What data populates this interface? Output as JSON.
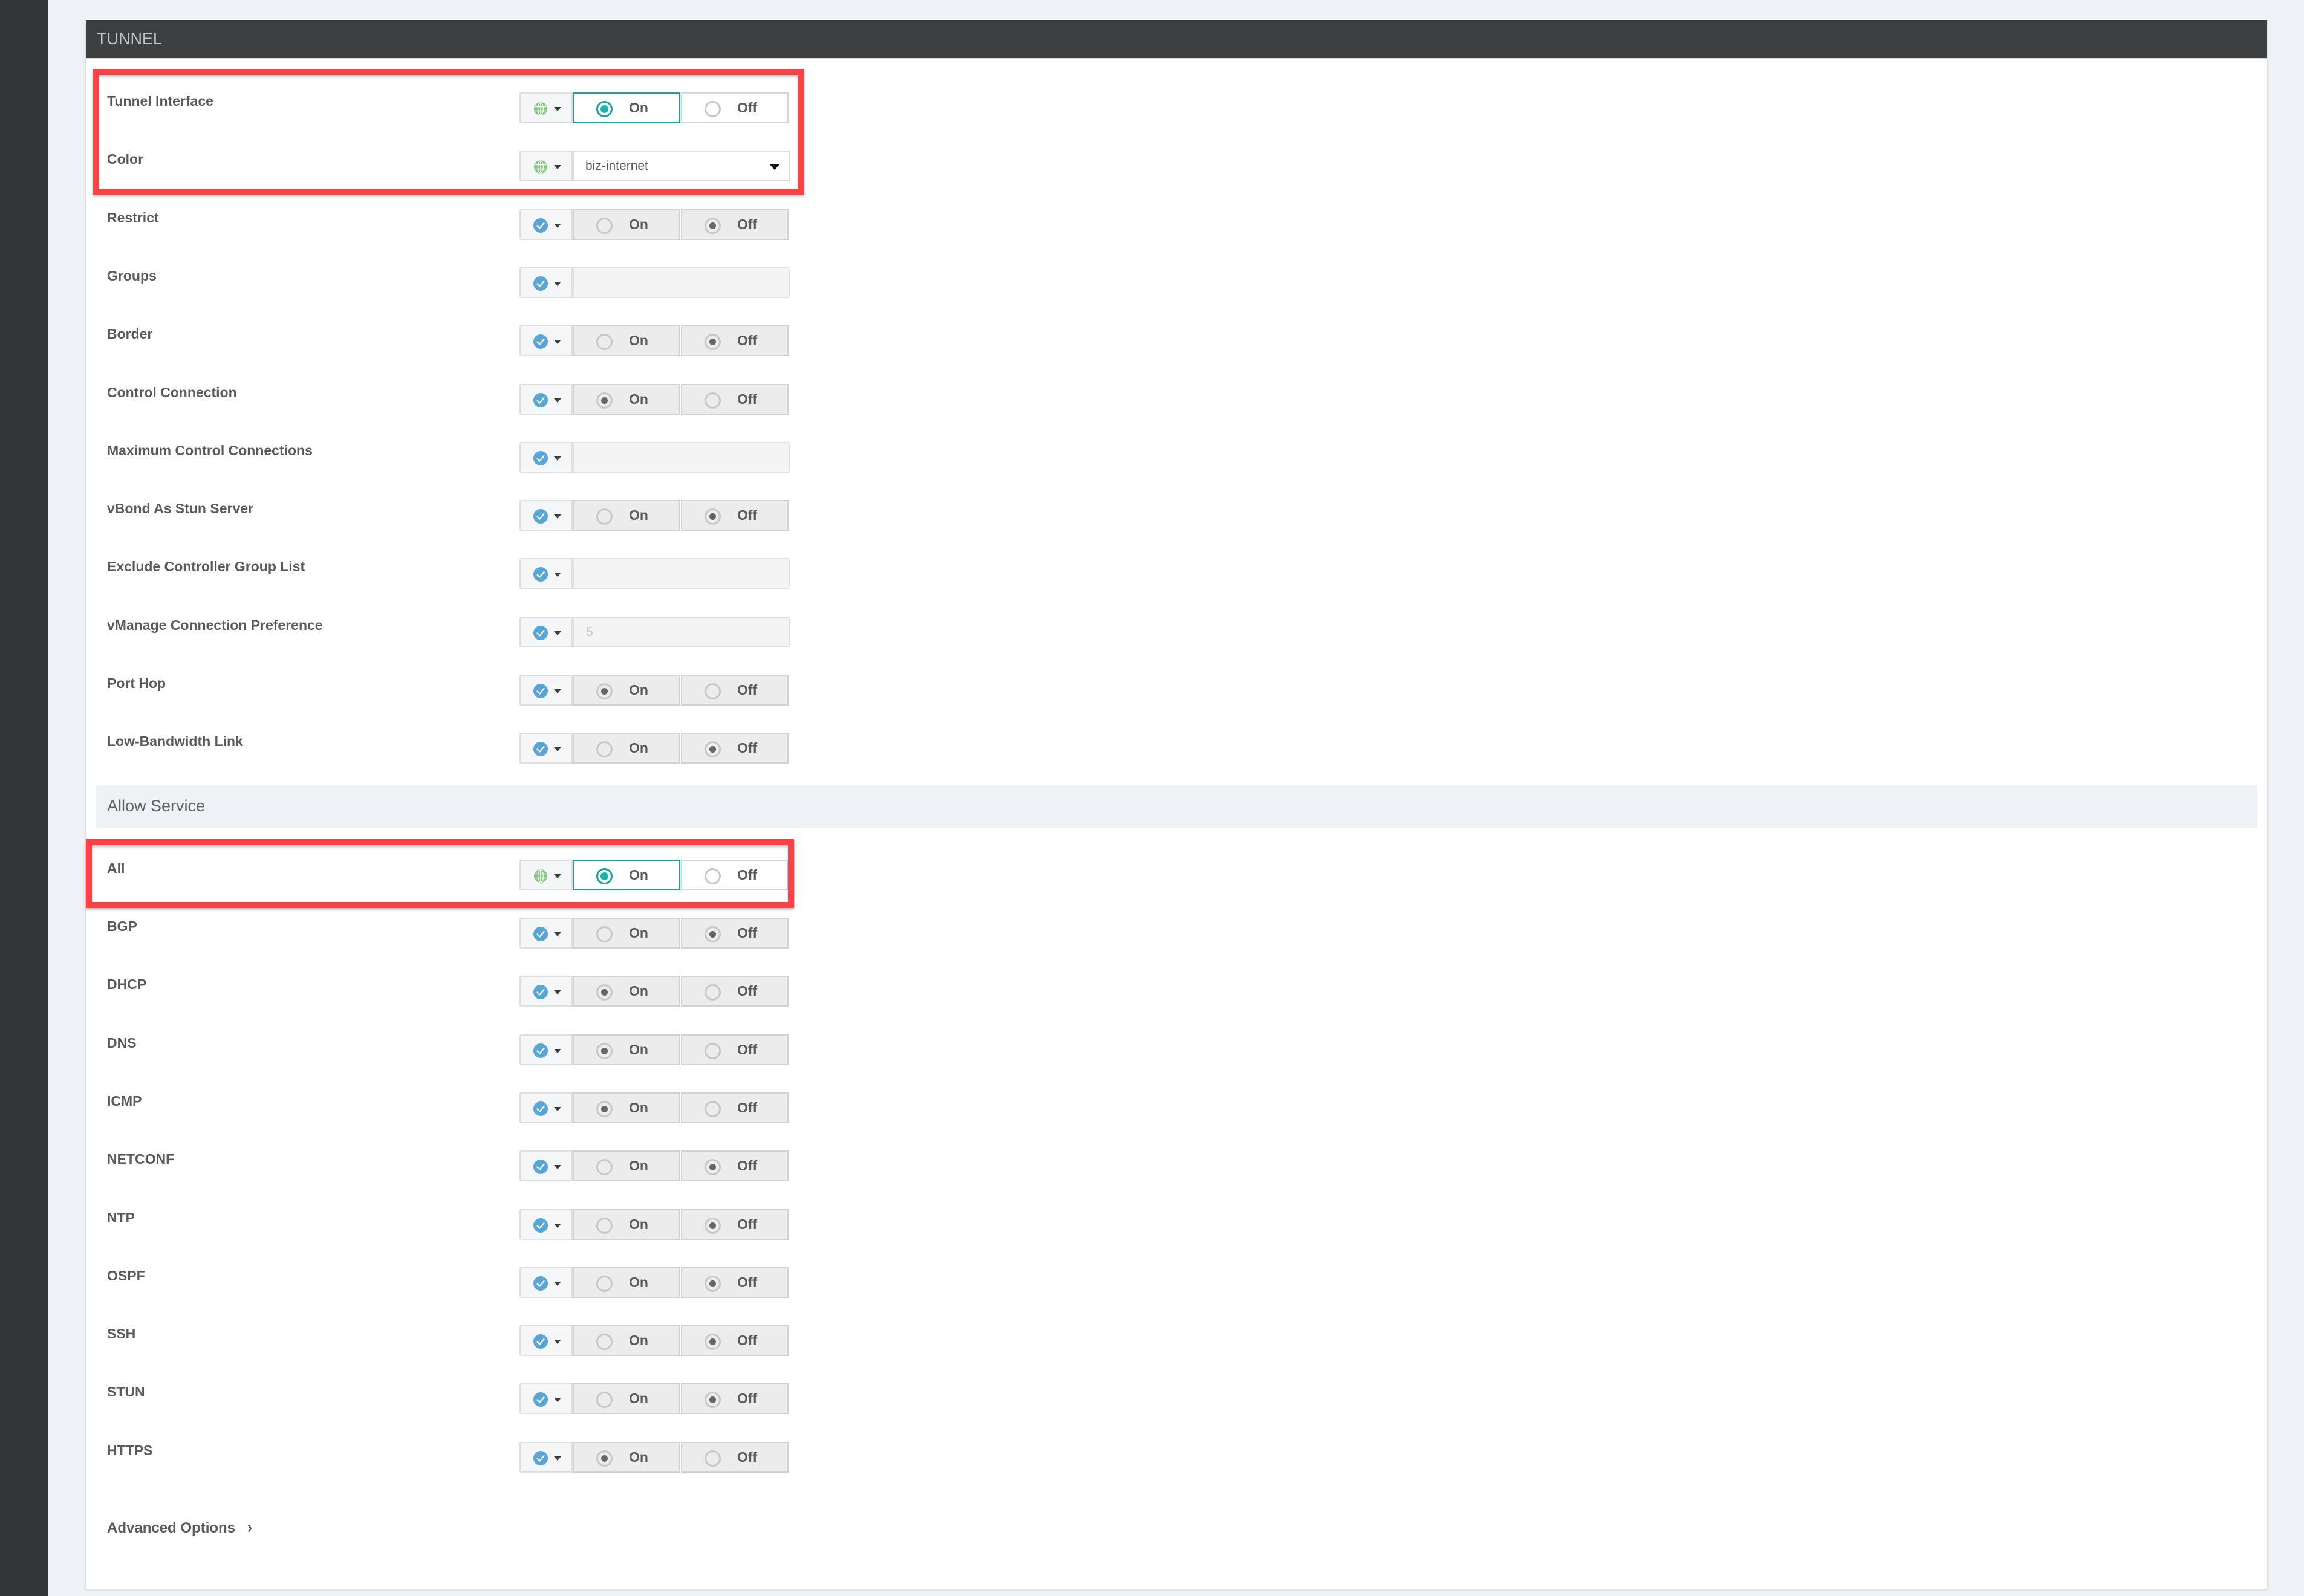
{
  "colors": {
    "accent_teal": "#1aa39c",
    "highlight_red": "#fd4245",
    "globe_green": "#7dc97b",
    "check_blue": "#58a6d6",
    "header_bg": "#3e3f41"
  },
  "section": {
    "title": "TUNNEL"
  },
  "scope_icons": {
    "global": "globe-icon",
    "default": "check-circle-icon"
  },
  "tunnel_rows": [
    {
      "label": "Tunnel Interface",
      "scope": "global",
      "type": "radio",
      "on_label": "On",
      "off_label": "Off",
      "value": "On",
      "highlighted": true
    },
    {
      "label": "Color",
      "scope": "global",
      "type": "select",
      "value": "biz-internet",
      "highlighted": true
    },
    {
      "label": "Restrict",
      "scope": "default",
      "type": "radio",
      "on_label": "On",
      "off_label": "Off",
      "value": "Off"
    },
    {
      "label": "Groups",
      "scope": "default",
      "type": "text",
      "value": "",
      "placeholder": ""
    },
    {
      "label": "Border",
      "scope": "default",
      "type": "radio",
      "on_label": "On",
      "off_label": "Off",
      "value": "Off"
    },
    {
      "label": "Control Connection",
      "scope": "default",
      "type": "radio",
      "on_label": "On",
      "off_label": "Off",
      "value": "On"
    },
    {
      "label": "Maximum Control Connections",
      "scope": "default",
      "type": "text",
      "value": "",
      "placeholder": ""
    },
    {
      "label": "vBond As Stun Server",
      "scope": "default",
      "type": "radio",
      "on_label": "On",
      "off_label": "Off",
      "value": "Off"
    },
    {
      "label": "Exclude Controller Group List",
      "scope": "default",
      "type": "text",
      "value": "",
      "placeholder": ""
    },
    {
      "label": "vManage Connection Preference",
      "scope": "default",
      "type": "text",
      "value": "",
      "placeholder": "5"
    },
    {
      "label": "Port Hop",
      "scope": "default",
      "type": "radio",
      "on_label": "On",
      "off_label": "Off",
      "value": "On"
    },
    {
      "label": "Low-Bandwidth Link",
      "scope": "default",
      "type": "radio",
      "on_label": "On",
      "off_label": "Off",
      "value": "Off"
    }
  ],
  "allow_service": {
    "title": "Allow Service",
    "rows": [
      {
        "label": "All",
        "scope": "global",
        "type": "radio",
        "on_label": "On",
        "off_label": "Off",
        "value": "On",
        "highlighted": true
      },
      {
        "label": "BGP",
        "scope": "default",
        "type": "radio",
        "on_label": "On",
        "off_label": "Off",
        "value": "Off"
      },
      {
        "label": "DHCP",
        "scope": "default",
        "type": "radio",
        "on_label": "On",
        "off_label": "Off",
        "value": "On"
      },
      {
        "label": "DNS",
        "scope": "default",
        "type": "radio",
        "on_label": "On",
        "off_label": "Off",
        "value": "On"
      },
      {
        "label": "ICMP",
        "scope": "default",
        "type": "radio",
        "on_label": "On",
        "off_label": "Off",
        "value": "On"
      },
      {
        "label": "NETCONF",
        "scope": "default",
        "type": "radio",
        "on_label": "On",
        "off_label": "Off",
        "value": "Off"
      },
      {
        "label": "NTP",
        "scope": "default",
        "type": "radio",
        "on_label": "On",
        "off_label": "Off",
        "value": "Off"
      },
      {
        "label": "OSPF",
        "scope": "default",
        "type": "radio",
        "on_label": "On",
        "off_label": "Off",
        "value": "Off"
      },
      {
        "label": "SSH",
        "scope": "default",
        "type": "radio",
        "on_label": "On",
        "off_label": "Off",
        "value": "Off"
      },
      {
        "label": "STUN",
        "scope": "default",
        "type": "radio",
        "on_label": "On",
        "off_label": "Off",
        "value": "Off"
      },
      {
        "label": "HTTPS",
        "scope": "default",
        "type": "radio",
        "on_label": "On",
        "off_label": "Off",
        "value": "On"
      }
    ]
  },
  "advanced_options": {
    "label": "Advanced Options",
    "chevron_icon": "chevron-right-icon"
  }
}
